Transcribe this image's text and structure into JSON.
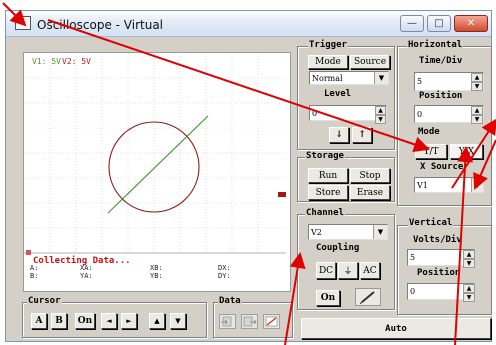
{
  "window": {
    "title": "Oscilloscope - Virtual",
    "minimize": "—",
    "maximize": "□",
    "close": "✕"
  },
  "screen": {
    "channel_labels": [
      {
        "text": "V1: 5V",
        "color": "#4c9a2a"
      },
      {
        "text": "V2: 5V",
        "color": "#c0181a"
      }
    ],
    "status": "Collecting Data...",
    "readout_rows": [
      [
        "A:",
        "XA:",
        "XB:",
        "DX:"
      ],
      [
        "B:",
        "YA:",
        "YB:",
        "DY:"
      ]
    ]
  },
  "trigger": {
    "title": "Trigger",
    "mode_button": "Mode",
    "source_button": "Source",
    "mode_select": "Normal",
    "level_label": "Level",
    "level_value": "0",
    "falling_edge": "↓",
    "rising_edge": "↑"
  },
  "storage": {
    "title": "Storage",
    "run": "Run",
    "stop": "Stop",
    "store": "Store",
    "erase": "Erase"
  },
  "channel": {
    "title": "Channel",
    "select": "V2",
    "coupling_label": "Coupling",
    "dc": "DC",
    "gnd": "⏚",
    "ac": "AC",
    "on": "On"
  },
  "horizontal": {
    "title": "Horizontal",
    "time_div_label": "Time/Div",
    "time_div_value": "5",
    "position_label": "Position",
    "position_value": "0",
    "mode_label": "Mode",
    "yt_button": "Y/T",
    "yx_button": "Y/X",
    "xsource_label": "X Source",
    "xsource_value": "V1"
  },
  "vertical": {
    "title": "Vertical",
    "volts_div_label": "Volts/Div",
    "volts_div_value": "5",
    "position_label": "Position",
    "position_value": "0"
  },
  "cursor": {
    "title": "Cursor",
    "a": "A",
    "b": "B",
    "on": "On",
    "left": "◄",
    "right": "►",
    "up": "▲",
    "down": "▼"
  },
  "data_group": {
    "title": "Data"
  },
  "auto_button": "Auto",
  "colors": {
    "trace_green": "#3a9a2a",
    "trace_red": "#8e1f1f",
    "arrow_red": "#e00000",
    "window_bg": "#d4d0c8"
  }
}
